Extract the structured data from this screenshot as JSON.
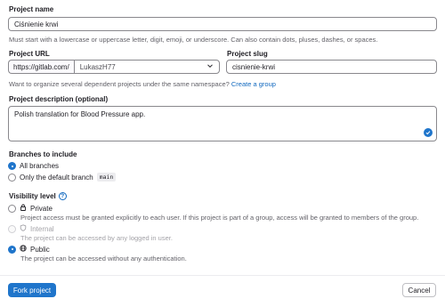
{
  "project_name": {
    "label": "Project name",
    "value": "Ciśnienie krwi",
    "help": "Must start with a lowercase or uppercase letter, digit, emoji, or underscore. Can also contain dots, pluses, dashes, or spaces."
  },
  "project_url": {
    "label": "Project URL",
    "prefix": "https://gitlab.com/",
    "namespace": "LukaszH77",
    "help_text": "Want to organize several dependent projects under the same namespace?",
    "help_link": "Create a group"
  },
  "project_slug": {
    "label": "Project slug",
    "value": "cisnienie-krwi"
  },
  "description": {
    "label": "Project description (optional)",
    "value": "Polish translation for Blood Pressure app."
  },
  "branches": {
    "label": "Branches to include",
    "options": [
      {
        "label": "All branches",
        "checked": true
      },
      {
        "label": "Only the default branch",
        "code": "main",
        "checked": false
      }
    ]
  },
  "visibility": {
    "label": "Visibility level",
    "options": [
      {
        "title": "Private",
        "desc": "Project access must be granted explicitly to each user. If this project is part of a group, access will be granted to members of the group.",
        "icon": "lock-icon",
        "checked": false,
        "disabled": false
      },
      {
        "title": "Internal",
        "desc": "The project can be accessed by any logged in user.",
        "icon": "shield-icon",
        "checked": false,
        "disabled": true
      },
      {
        "title": "Public",
        "desc": "The project can be accessed without any authentication.",
        "icon": "earth-icon",
        "checked": true,
        "disabled": false
      }
    ]
  },
  "actions": {
    "fork": "Fork project",
    "cancel": "Cancel"
  },
  "colors": {
    "primary": "#1f75cb",
    "link": "#1068bf",
    "border": "#89888d",
    "muted": "#626168"
  }
}
